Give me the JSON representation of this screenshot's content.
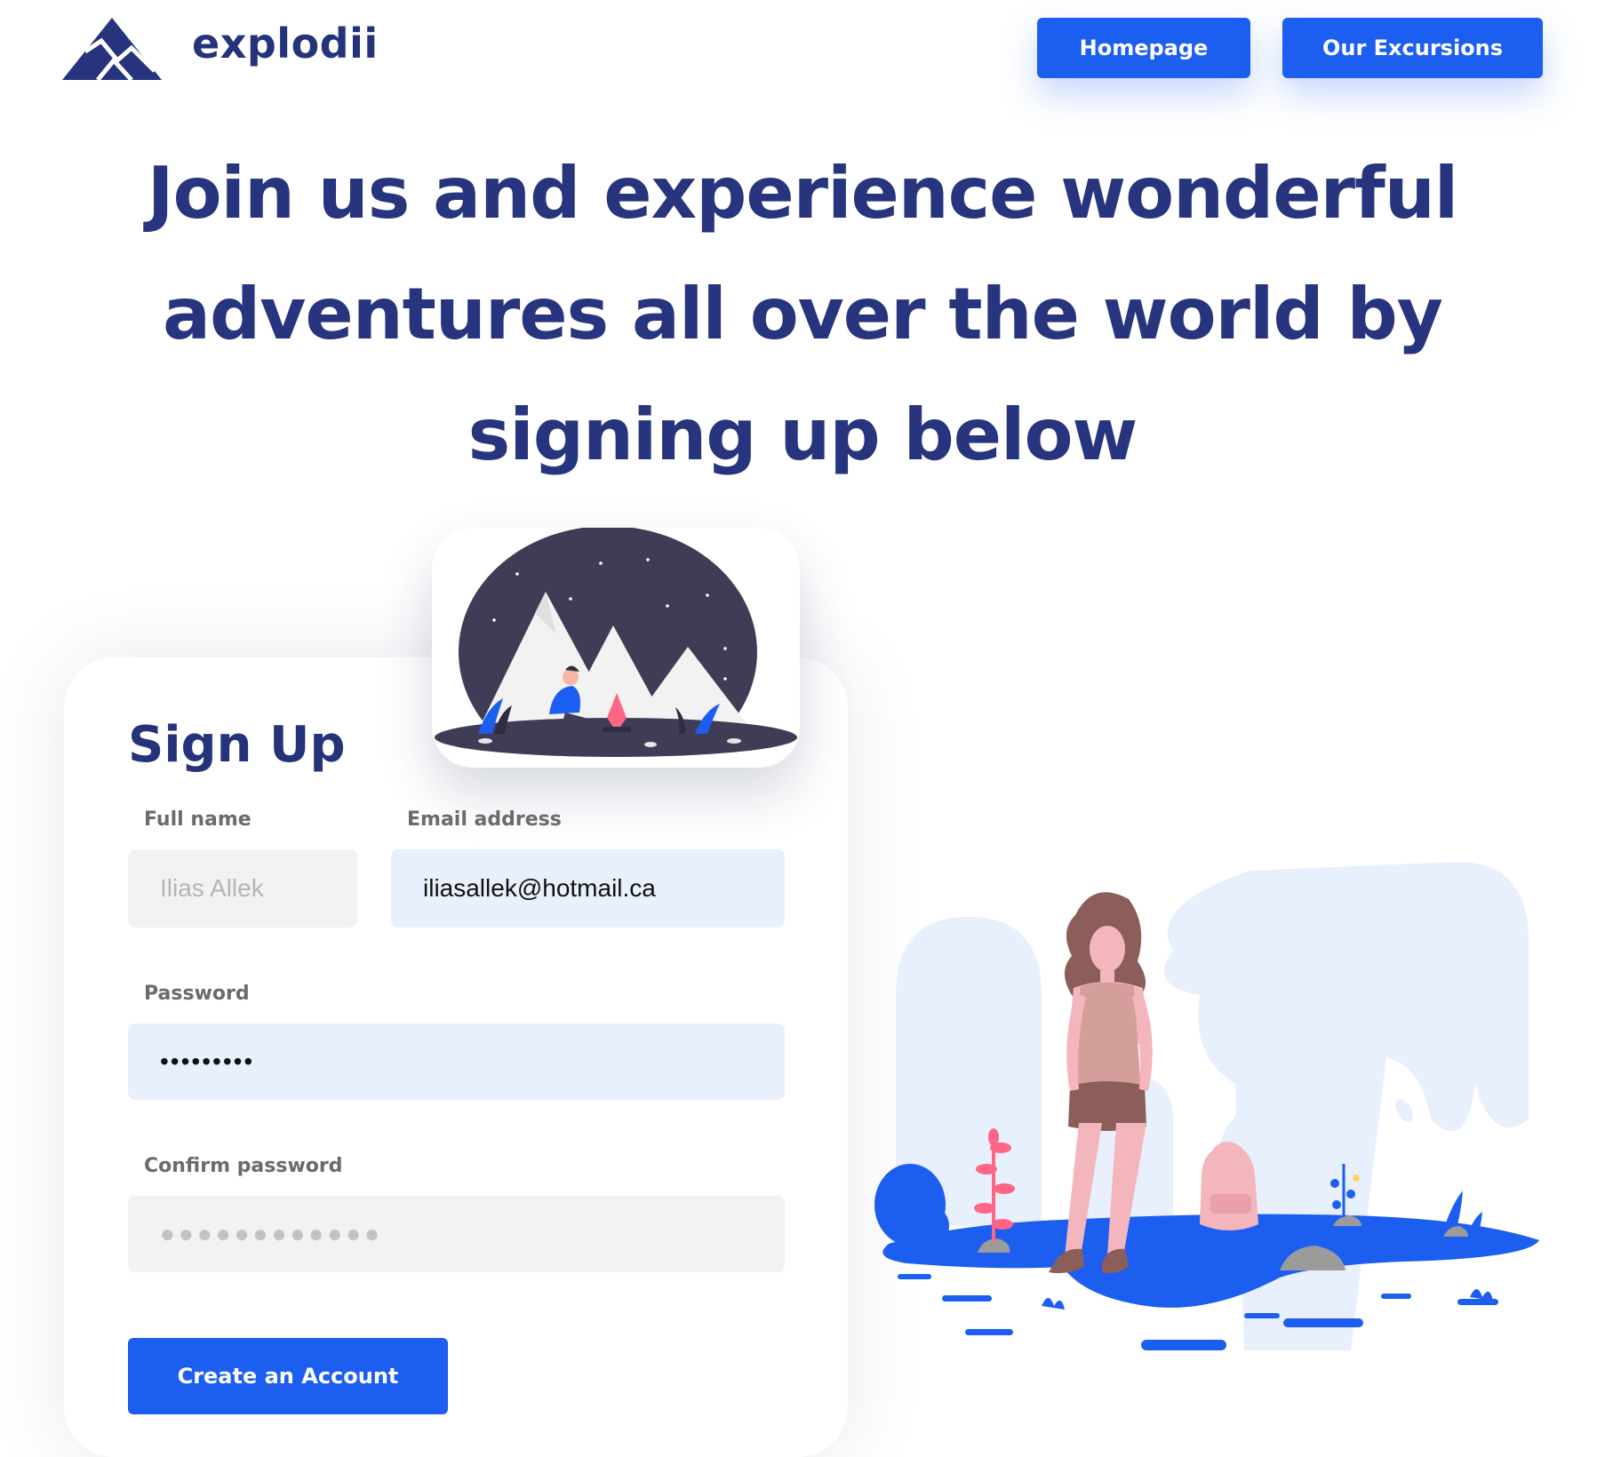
{
  "brand": {
    "name": "explodii"
  },
  "nav": {
    "homepage_label": "Homepage",
    "excursions_label": "Our Excursions"
  },
  "hero": {
    "headline": "Join us and experience wonderful adventures all over the world by signing up below"
  },
  "signup": {
    "title": "Sign Up",
    "full_name": {
      "label": "Full name",
      "placeholder": "Ilias Allek",
      "value": ""
    },
    "email": {
      "label": "Email address",
      "value": "iliasallek@hotmail.ca"
    },
    "password": {
      "label": "Password",
      "value": "secret123"
    },
    "confirm_password": {
      "label": "Confirm password",
      "placeholder": "●●●●●●●●●●●●",
      "value": ""
    },
    "submit_label": "Create an Account"
  },
  "colors": {
    "primary": "#1c5ef0",
    "brand_navy": "#25337a",
    "filled_field": "#e8effd",
    "empty_field": "#f2f2f2"
  },
  "icons": [
    "mountain-logo-icon"
  ],
  "illustrations": [
    "camping-night-illustration",
    "hiker-woman-illustration"
  ]
}
